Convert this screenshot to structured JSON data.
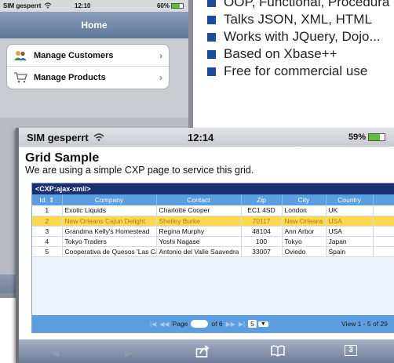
{
  "back_phone": {
    "status": {
      "carrier": "SIM gesperrt",
      "time": "12:10",
      "battery": "60%"
    },
    "nav_title": "Home",
    "items": [
      {
        "label": "Manage Customers",
        "icon": "users-icon"
      },
      {
        "label": "Manage Products",
        "icon": "cart-icon"
      }
    ]
  },
  "features": [
    "OOP, Functional, Procedura",
    "Talks JSON, XML, HTML",
    "Works with JQuery, Dojo...",
    "Based on Xbase++",
    "Free for commercial use"
  ],
  "front_phone": {
    "status": {
      "carrier": "SIM gesperrt",
      "time": "12:14",
      "battery": "59%"
    },
    "page_title": "Grid Sample",
    "page_subtitle": "We are using a simple CXP page to service this grid.",
    "grid": {
      "caption": "<CXP:ajax-xml/>",
      "columns": [
        "Id.",
        "Company",
        "Contact",
        "Zip",
        "City",
        "Country"
      ],
      "rows": [
        {
          "id": "1",
          "company": "Exotic Liquids",
          "contact": "Charlotte Cooper",
          "zip": "EC1 4SD",
          "city": "London",
          "country": "UK"
        },
        {
          "id": "2",
          "company": "New Orleans Cajun Delight",
          "contact": "Shelley Burke",
          "zip": "70117",
          "city": "New Orleans",
          "country": "USA"
        },
        {
          "id": "3",
          "company": "Grandma Kelly's Homestead",
          "contact": "Regina Murphy",
          "zip": "48104",
          "city": "Ann Arbor",
          "country": "USA"
        },
        {
          "id": "4",
          "company": "Tokyo Traders",
          "contact": "Yoshi Nagase",
          "zip": "100",
          "city": "Tokyo",
          "country": "Japan"
        },
        {
          "id": "5",
          "company": "Cooperativa de Quesos 'Las Cabras'",
          "contact": "Antonio del Valle Saavedra",
          "zip": "33007",
          "city": "Oviedo",
          "country": "Spain"
        }
      ],
      "selected_row": 2,
      "pager": {
        "page_label": "Page",
        "of_label": "of 6",
        "page_size": "5",
        "view_text": "View 1 - 5 of 29"
      }
    },
    "toolbar": {
      "icons": [
        "back-icon",
        "forward-icon",
        "share-icon",
        "bookmarks-icon",
        "tabs-icon"
      ],
      "tabs_count": "3"
    }
  },
  "colors": {
    "bullet": "#1b4b9c",
    "grid_header": "#5b9fe0",
    "grid_caption": "#1b2f73",
    "row_highlight": "#fbd850"
  }
}
